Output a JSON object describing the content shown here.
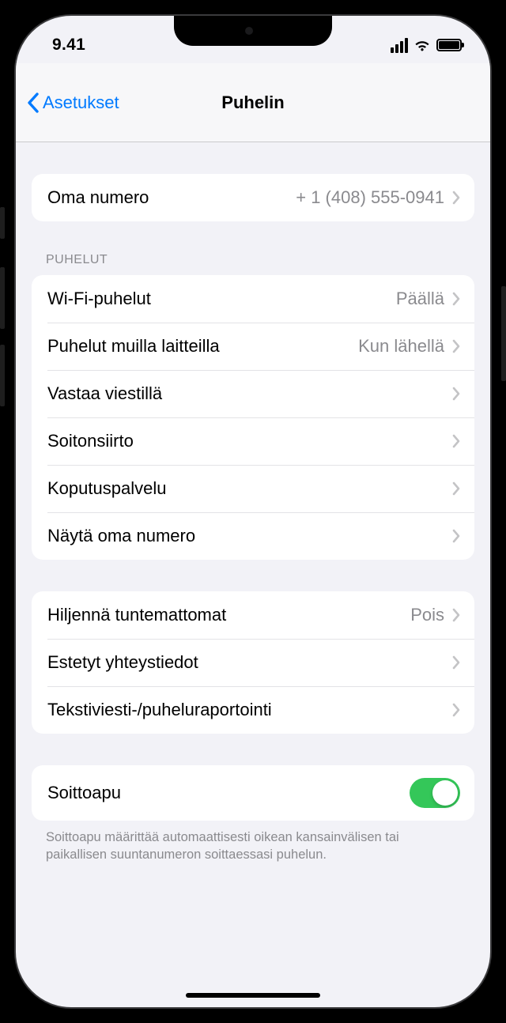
{
  "status": {
    "time": "9.41"
  },
  "nav": {
    "back": "Asetukset",
    "title": "Puhelin"
  },
  "sections": {
    "my_number": {
      "label": "Oma numero",
      "value": "+ 1 (408) 555-0941"
    },
    "calls_header": "PUHELUT",
    "calls": [
      {
        "label": "Wi-Fi-puhelut",
        "value": "Päällä"
      },
      {
        "label": "Puhelut muilla laitteilla",
        "value": "Kun lähellä"
      },
      {
        "label": "Vastaa viestillä",
        "value": ""
      },
      {
        "label": "Soitonsiirto",
        "value": ""
      },
      {
        "label": "Koputuspalvelu",
        "value": ""
      },
      {
        "label": "Näytä oma numero",
        "value": ""
      }
    ],
    "silence": [
      {
        "label": "Hiljennä tuntemattomat",
        "value": "Pois"
      },
      {
        "label": "Estetyt yhteystiedot",
        "value": ""
      },
      {
        "label": "Tekstiviesti-/puheluraportointi",
        "value": ""
      }
    ],
    "dial_assist": {
      "label": "Soittoapu",
      "footer": "Soittoapu määrittää automaattisesti oikean kansainvälisen tai paikallisen suuntanumeron soittaessasi puhelun."
    }
  }
}
